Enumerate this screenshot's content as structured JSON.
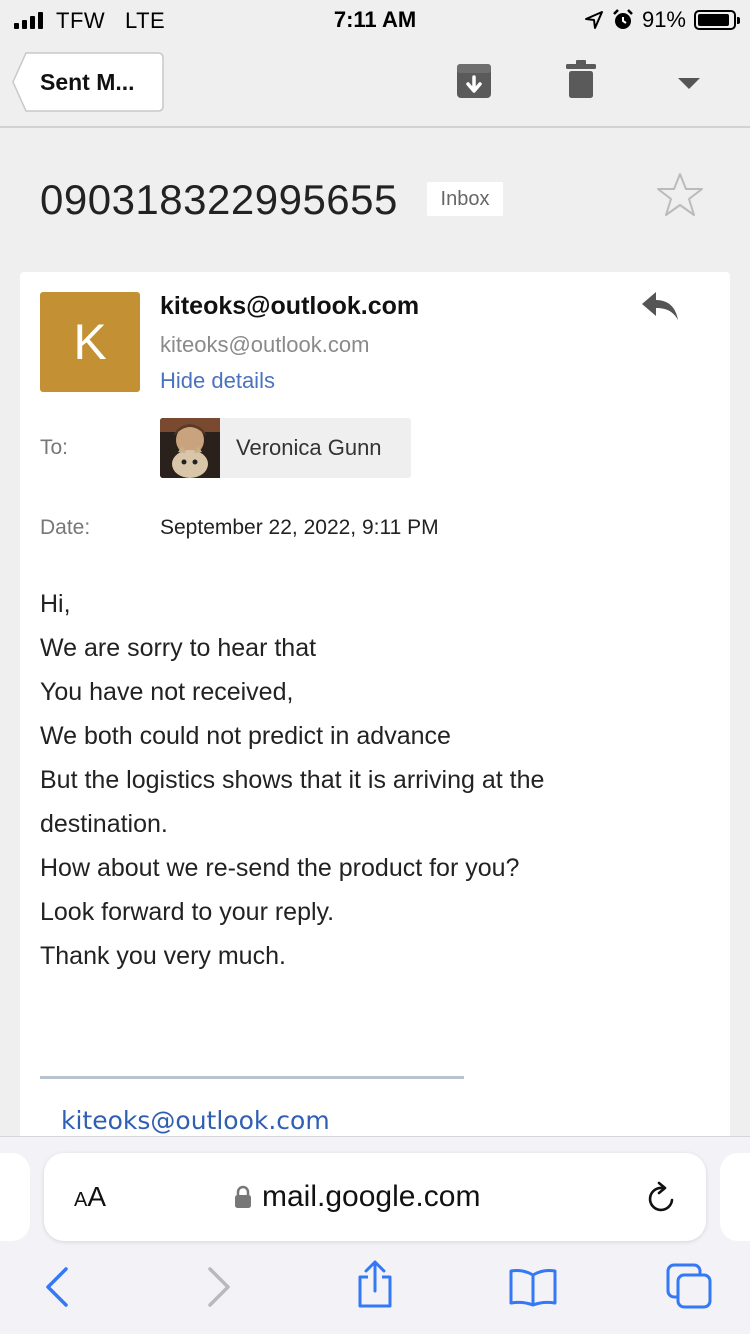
{
  "status_bar": {
    "carrier": "TFW",
    "network": "LTE",
    "time": "7:11 AM",
    "battery": "91%",
    "battery_level": 0.91
  },
  "toolbar": {
    "back_label": "Sent M..."
  },
  "email": {
    "subject": "090318322995655",
    "label": "Inbox",
    "sender_initial": "K",
    "avatar_color": "#c39133",
    "sender_name": "kiteoks@outlook.com",
    "sender_email": "kiteoks@outlook.com",
    "hide_details": "Hide details",
    "to_label": "To:",
    "recipient_name": "Veronica Gunn",
    "date_label": "Date:",
    "date_value": "September 22, 2022, 9:11 PM",
    "body_lines": [
      "Hi,",
      "We are sorry to hear that",
      "You have not received,",
      "We both could not predict in advance",
      "But the logistics shows that it is arriving at the destination.",
      "How about we re-send the product for you?",
      "Look forward to your reply.",
      "Thank you very much."
    ],
    "signature": "kiteoks@outlook.com"
  },
  "browser": {
    "text_size_small": "A",
    "text_size_big": "A",
    "url": "mail.google.com",
    "accent_color": "#3478f6"
  }
}
